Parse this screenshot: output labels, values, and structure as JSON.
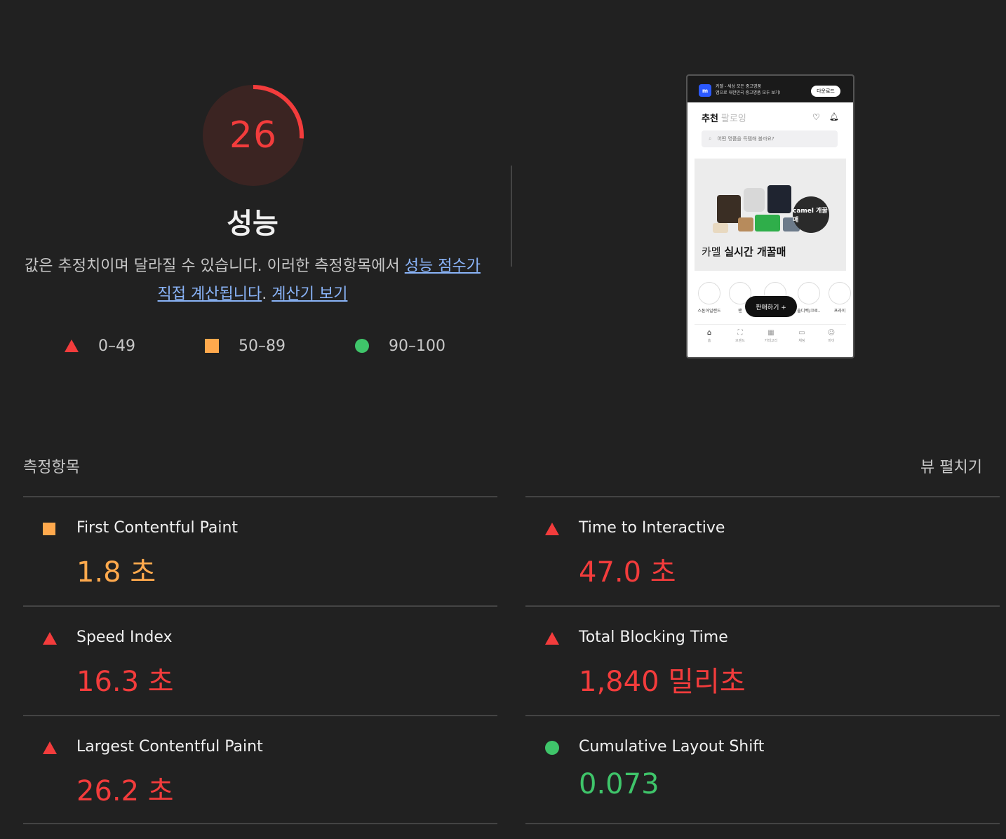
{
  "score": {
    "value": "26",
    "fraction": 0.26,
    "label": "성능",
    "color": "#f33c3c",
    "track_color": "#3b2422"
  },
  "description": {
    "text": "값은 추정치이며 달라질 수 있습니다. 이러한 측정항목에서 ",
    "link1": "성능 점수가 직접 계산됩니다",
    "sep": ". ",
    "link2": "계산기 보기"
  },
  "legend": [
    {
      "icon": "triangle-icon",
      "range": "0–49",
      "color": "#f33c3c"
    },
    {
      "icon": "square-icon",
      "range": "50–89",
      "color": "#ffa94d"
    },
    {
      "icon": "circle-icon",
      "range": "90–100",
      "color": "#3fc56a"
    }
  ],
  "screenshot": {
    "banner_line1": "카멜 - 세상 모든 중고명품",
    "banner_line2": "앱으로 대한민국 중고명품 모두 보기!",
    "download": "다운로드",
    "tab_active": "추천",
    "tab_inactive": "팔로잉",
    "search_placeholder": "어떤 명품을 득템해 볼까요?",
    "badge": "camel 개꿀매",
    "hero_title_light": "카멜 ",
    "hero_title_bold": "실시간 개꿀매",
    "brands": [
      "스톤아일랜드",
      "맨",
      "",
      "솔디백/크로..",
      "프라이"
    ],
    "sell_button": "판매하기 +",
    "nav": [
      "홈",
      "브랜드",
      "카테고리",
      "채팅",
      "마이"
    ]
  },
  "metrics": {
    "title": "측정항목",
    "expand_label": "뷰 펼치기",
    "items": [
      {
        "label": "First Contentful Paint",
        "value": "1.8 초",
        "status": "average",
        "color": "#ffa94d"
      },
      {
        "label": "Time to Interactive",
        "value": "47.0 초",
        "status": "fail",
        "color": "#f33c3c"
      },
      {
        "label": "Speed Index",
        "value": "16.3 초",
        "status": "fail",
        "color": "#f33c3c"
      },
      {
        "label": "Total Blocking Time",
        "value": "1,840 밀리초",
        "status": "fail",
        "color": "#f33c3c"
      },
      {
        "label": "Largest Contentful Paint",
        "value": "26.2 초",
        "status": "fail",
        "color": "#f33c3c"
      },
      {
        "label": "Cumulative Layout Shift",
        "value": "0.073",
        "status": "pass",
        "color": "#3fc56a"
      }
    ]
  }
}
